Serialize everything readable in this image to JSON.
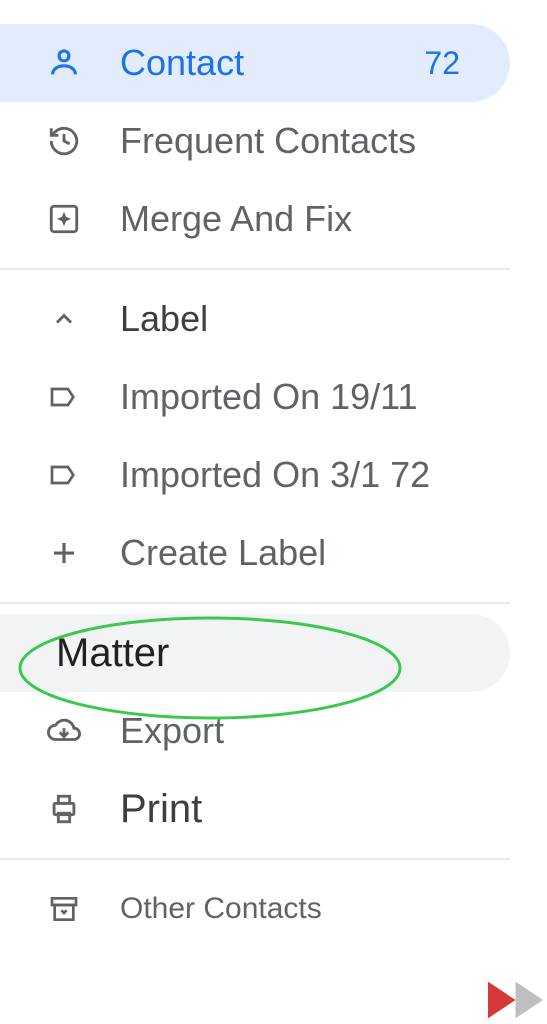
{
  "nav": {
    "contact": {
      "label": "Contact",
      "count": "72"
    },
    "frequent": {
      "label": "Frequent Contacts"
    },
    "merge": {
      "label": "Merge And Fix"
    }
  },
  "labels": {
    "header": "Label",
    "items": [
      {
        "label": "Imported On 19/11"
      },
      {
        "label": "Imported On 3/1 72"
      }
    ],
    "create": "Create Label"
  },
  "actions": {
    "import": "Matter",
    "export": "Export",
    "print": "Print"
  },
  "other": {
    "label": "Other Contacts"
  }
}
